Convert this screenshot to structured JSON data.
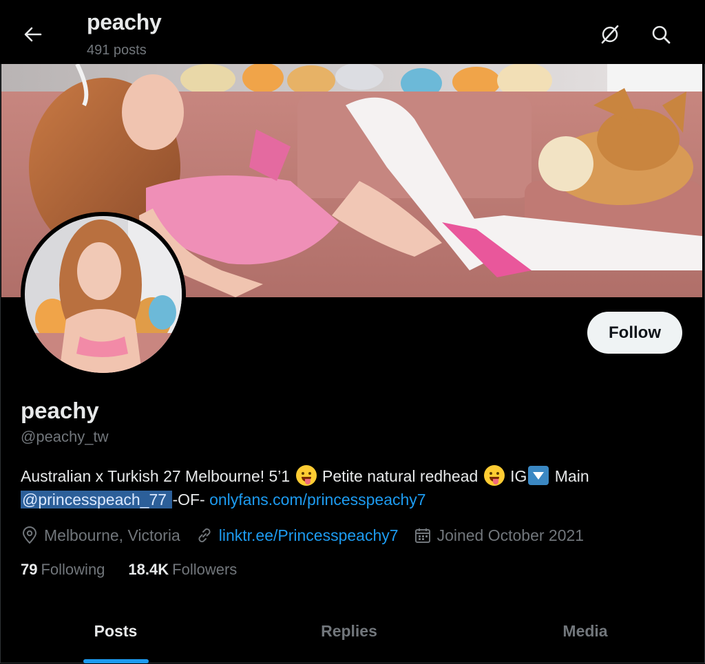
{
  "header": {
    "title": "peachy",
    "post_count": "491 posts",
    "icons": [
      "back-arrow-icon",
      "no-signal-icon",
      "search-icon"
    ]
  },
  "profile": {
    "display_name": "peachy",
    "handle": "@peachy_tw",
    "follow_label": "Follow",
    "bio": {
      "part1": "Australian x Turkish 27 Melbourne! 5’1 ",
      "part2": " Petite natural redhead ",
      "part3": " IG",
      "part4": " Main",
      "mention": "@princesspeach_77 ",
      "part5": " -OF- ",
      "link": "onlyfans.com/princesspeachy7"
    },
    "location": "Melbourne, Victoria",
    "website": "linktr.ee/Princesspeachy7",
    "joined": "Joined October 2021",
    "following_count": "79",
    "following_label": "Following",
    "followers_count": "18.4K",
    "followers_label": "Followers"
  },
  "tabs": [
    {
      "label": "Posts",
      "active": true
    },
    {
      "label": "Replies",
      "active": false
    },
    {
      "label": "Media",
      "active": false
    }
  ],
  "colors": {
    "background": "#000000",
    "text_primary": "#e7e9ea",
    "text_secondary": "#71767b",
    "accent": "#1d9bf0",
    "follow_button": "#eff3f4"
  }
}
